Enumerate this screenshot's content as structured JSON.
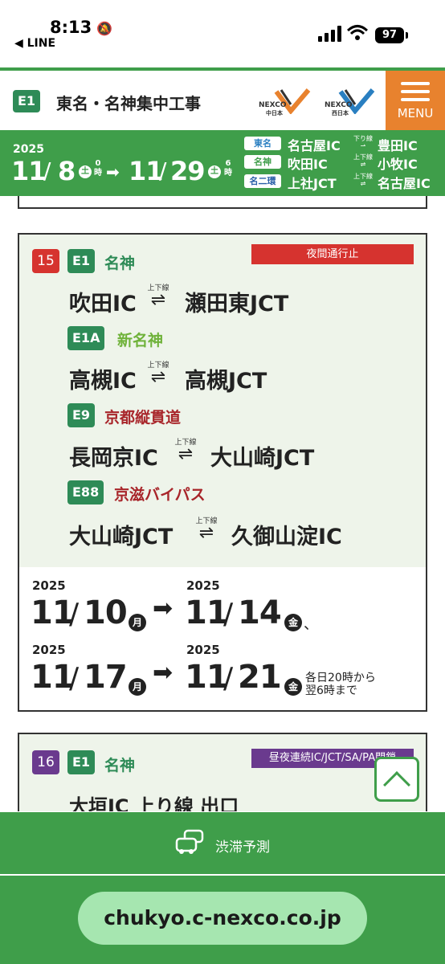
{
  "status_bar": {
    "time": "8:13",
    "back_app": "◀ LINE",
    "battery": "97"
  },
  "header": {
    "route_badge": "E1",
    "title": "東名・名神集中工事",
    "logo_left": "NEXCO",
    "logo_left_sub": "中日本",
    "logo_right": "NEXCO",
    "logo_right_sub": "西日本",
    "menu_label": "MENU"
  },
  "banner": {
    "year": "2025",
    "start_month": "11",
    "start_day": "8",
    "start_weekday": "土",
    "start_hour": "0",
    "hour_unit": "時",
    "end_month": "11",
    "end_day": "29",
    "end_weekday": "土",
    "end_hour": "6",
    "routes": [
      {
        "tag": "東名",
        "from": "名古屋IC",
        "dir": "下り線",
        "to": "豊田IC"
      },
      {
        "tag": "名神",
        "from": "吹田IC",
        "dir": "上下線",
        "to": "小牧IC"
      },
      {
        "tag": "名二環",
        "from": "上社JCT",
        "dir": "上下線",
        "to": "名古屋IC"
      }
    ]
  },
  "card15": {
    "number": "15",
    "closure": "夜間通行止",
    "both_dir": "上下線",
    "segments": [
      {
        "badge": "E1",
        "road": "名神",
        "from": "吹田IC",
        "to": "瀬田東JCT"
      },
      {
        "badge": "E1A",
        "road": "新名神",
        "from": "高槻IC",
        "to": "高槻JCT"
      },
      {
        "badge": "E9",
        "road": "京都縦貫道",
        "from": "長岡京IC",
        "to": "大山崎JCT"
      },
      {
        "badge": "E88",
        "road": "京滋バイパス",
        "from": "大山崎JCT",
        "to": "久御山淀IC"
      }
    ],
    "periods": [
      {
        "year1": "2025",
        "m1": "11",
        "d1": "10",
        "w1": "月",
        "year2": "2025",
        "m2": "11",
        "d2": "14",
        "w2": "金",
        "sep": "、"
      },
      {
        "year1": "2025",
        "m1": "11",
        "d1": "17",
        "w1": "月",
        "year2": "2025",
        "m2": "11",
        "d2": "21",
        "w2": "金"
      }
    ],
    "note_line1": "各日20時から",
    "note_line2": "翌6時まで"
  },
  "card16": {
    "number": "16",
    "badge": "E1",
    "road": "名神",
    "tag": "昼夜連続IC/JCT/SA/PA閉鎖",
    "partial_text": "大垣IC 上り線 出口"
  },
  "bottom": {
    "jam_label": "渋滞予測",
    "url": "chukyo.c-nexco.co.jp"
  }
}
